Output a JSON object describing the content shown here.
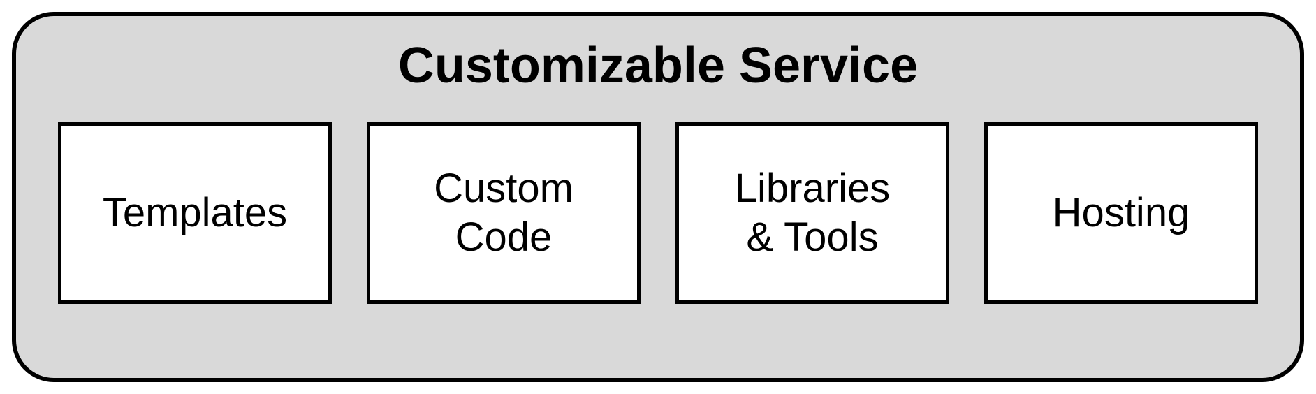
{
  "title": "Customizable Service",
  "boxes": [
    {
      "label": "Templates"
    },
    {
      "label": "Custom\nCode"
    },
    {
      "label": "Libraries\n& Tools"
    },
    {
      "label": "Hosting"
    }
  ]
}
